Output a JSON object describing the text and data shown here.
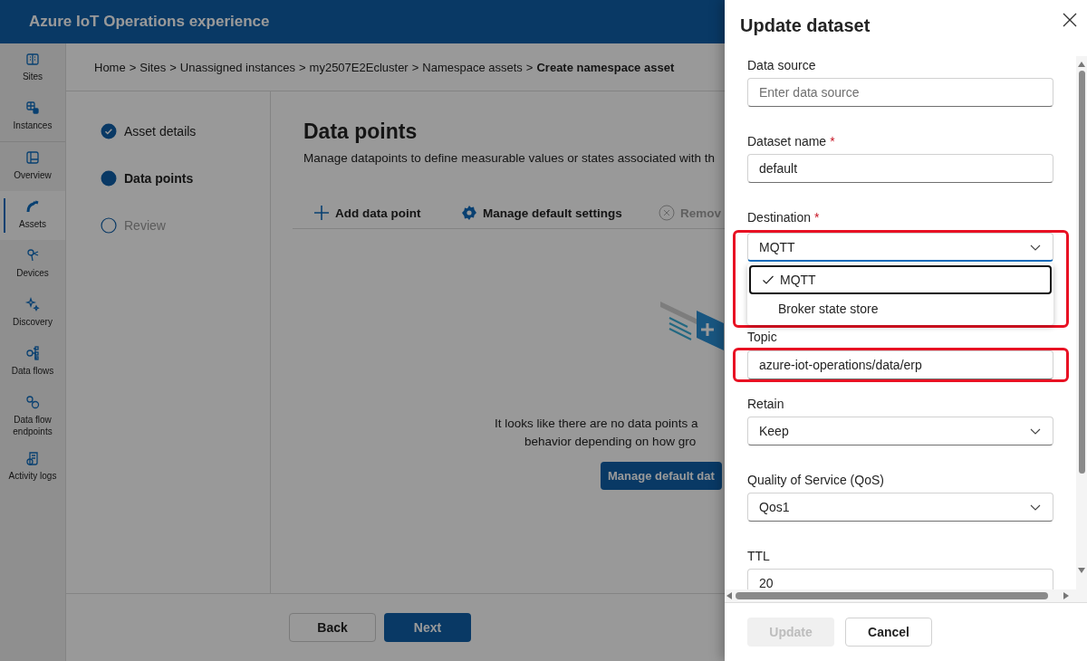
{
  "header": {
    "title": "Azure IoT Operations experience"
  },
  "sidebar": {
    "groups": [
      [
        {
          "label": "Sites",
          "selected": false
        },
        {
          "label": "Instances",
          "selected": false
        }
      ],
      [
        {
          "label": "Overview",
          "selected": false
        },
        {
          "label": "Assets",
          "selected": true
        },
        {
          "label": "Devices",
          "selected": false
        },
        {
          "label": "Discovery",
          "selected": false
        },
        {
          "label": "Data flows",
          "selected": false
        },
        {
          "label": "Data flow endpoints",
          "selected": false
        },
        {
          "label": "Activity logs",
          "selected": false
        }
      ]
    ]
  },
  "breadcrumb": {
    "separator": ">",
    "items": [
      {
        "label": "Home",
        "current": false
      },
      {
        "label": "Sites",
        "current": false
      },
      {
        "label": "Unassigned instances",
        "current": false
      },
      {
        "label": "my2507E2Ecluster",
        "current": false
      },
      {
        "label": "Namespace assets",
        "current": false
      },
      {
        "label": "Create namespace asset",
        "current": true
      }
    ]
  },
  "steps": [
    {
      "label": "Asset details",
      "kind": "done"
    },
    {
      "label": "Data points",
      "kind": "current"
    },
    {
      "label": "Review",
      "kind": "pending"
    }
  ],
  "page": {
    "title": "Data points",
    "description": "Manage datapoints to define measurable values or states associated with th",
    "toolbar": [
      {
        "label": "Add data point",
        "kind": "add",
        "disabled": false
      },
      {
        "label": "Manage default settings",
        "kind": "settings",
        "disabled": false
      },
      {
        "label": "Remov",
        "kind": "remove",
        "disabled": true
      }
    ],
    "empty_state": {
      "lines": [
        "It looks like there are no data points a",
        "behavior depending on how gro"
      ],
      "button": "Manage default dat"
    }
  },
  "footer": {
    "buttons": [
      {
        "label": "Back",
        "kind": "secondary"
      },
      {
        "label": "Next",
        "kind": "primary"
      }
    ]
  },
  "panel": {
    "title": "Update dataset",
    "fields": [
      {
        "kind": "input",
        "label": "Data source",
        "placeholder": "Enter data source",
        "highlighted": false
      },
      {
        "kind": "input",
        "label": "Dataset name",
        "required_mark": "*",
        "value": "default",
        "highlighted": false
      },
      {
        "kind": "select",
        "label": "Destination",
        "required_mark": "*",
        "value": "MQTT",
        "expanded": true,
        "highlighted": true,
        "options": [
          {
            "label": "MQTT",
            "selected": true
          },
          {
            "label": "Broker state store",
            "selected": false
          }
        ]
      },
      {
        "kind": "input",
        "label": "Topic",
        "value": "azure-iot-operations/data/erp",
        "highlighted": true
      },
      {
        "kind": "select",
        "label": "Retain",
        "value": "Keep",
        "expanded": false,
        "highlighted": false
      },
      {
        "kind": "select",
        "label": "Quality of Service (QoS)",
        "value": "Qos1",
        "expanded": false,
        "highlighted": false
      },
      {
        "kind": "input",
        "label": "TTL",
        "value": "20",
        "highlighted": false
      }
    ],
    "buttons": [
      {
        "label": "Update",
        "kind": "primary",
        "disabled": true
      },
      {
        "label": "Cancel",
        "kind": "secondary"
      }
    ]
  }
}
